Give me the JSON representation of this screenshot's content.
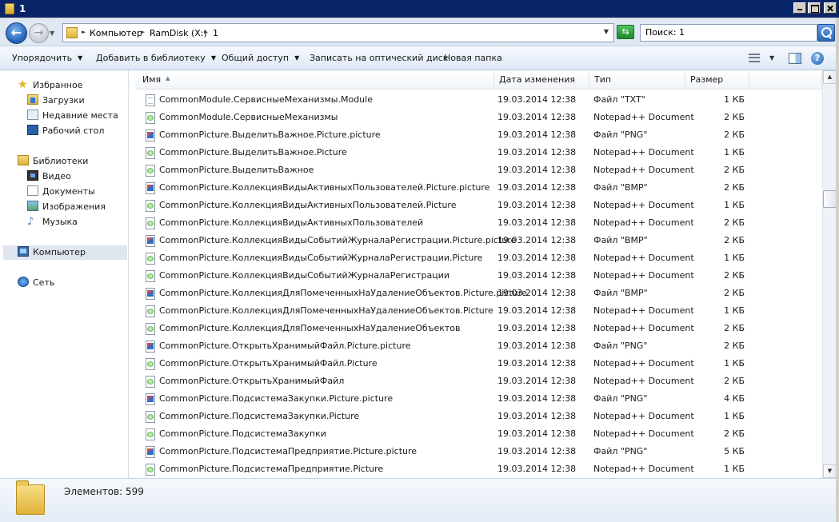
{
  "window": {
    "title": "1"
  },
  "address": {
    "crumbs": [
      "Компьютер",
      "RamDisk (X:)",
      "1"
    ],
    "search_placeholder": "Поиск: 1"
  },
  "toolbar": {
    "organize": "Упорядочить",
    "add_to_library": "Добавить в библиотеку",
    "share": "Общий доступ",
    "burn": "Записать на оптический диск",
    "new_folder": "Новая папка"
  },
  "nav": {
    "favorites": "Избранное",
    "downloads": "Загрузки",
    "recent": "Недавние места",
    "desktop": "Рабочий стол",
    "libraries": "Библиотеки",
    "video": "Видео",
    "documents": "Документы",
    "pictures": "Изображения",
    "music": "Музыка",
    "computer": "Компьютер",
    "network": "Сеть"
  },
  "columns": {
    "name": "Имя",
    "date": "Дата изменения",
    "type": "Тип",
    "size": "Размер"
  },
  "files": [
    {
      "icon": "txt",
      "name": "CommonModule.СервисныеМеханизмы.Module",
      "date": "19.03.2014 12:38",
      "type": "Файл \"TXT\"",
      "size": "1 КБ"
    },
    {
      "icon": "npp",
      "name": "CommonModule.СервисныеМеханизмы",
      "date": "19.03.2014 12:38",
      "type": "Notepad++ Document",
      "size": "2 КБ"
    },
    {
      "icon": "img",
      "name": "CommonPicture.ВыделитьВажное.Picture.picture",
      "date": "19.03.2014 12:38",
      "type": "Файл \"PNG\"",
      "size": "2 КБ"
    },
    {
      "icon": "npp",
      "name": "CommonPicture.ВыделитьВажное.Picture",
      "date": "19.03.2014 12:38",
      "type": "Notepad++ Document",
      "size": "1 КБ"
    },
    {
      "icon": "npp",
      "name": "CommonPicture.ВыделитьВажное",
      "date": "19.03.2014 12:38",
      "type": "Notepad++ Document",
      "size": "2 КБ"
    },
    {
      "icon": "img",
      "name": "CommonPicture.КоллекцияВидыАктивныхПользователей.Picture.picture",
      "date": "19.03.2014 12:38",
      "type": "Файл \"BMP\"",
      "size": "2 КБ"
    },
    {
      "icon": "npp",
      "name": "CommonPicture.КоллекцияВидыАктивныхПользователей.Picture",
      "date": "19.03.2014 12:38",
      "type": "Notepad++ Document",
      "size": "1 КБ"
    },
    {
      "icon": "npp",
      "name": "CommonPicture.КоллекцияВидыАктивныхПользователей",
      "date": "19.03.2014 12:38",
      "type": "Notepad++ Document",
      "size": "2 КБ"
    },
    {
      "icon": "img",
      "name": "CommonPicture.КоллекцияВидыСобытийЖурналаРегистрации.Picture.picture",
      "date": "19.03.2014 12:38",
      "type": "Файл \"BMP\"",
      "size": "2 КБ"
    },
    {
      "icon": "npp",
      "name": "CommonPicture.КоллекцияВидыСобытийЖурналаРегистрации.Picture",
      "date": "19.03.2014 12:38",
      "type": "Notepad++ Document",
      "size": "1 КБ"
    },
    {
      "icon": "npp",
      "name": "CommonPicture.КоллекцияВидыСобытийЖурналаРегистрации",
      "date": "19.03.2014 12:38",
      "type": "Notepad++ Document",
      "size": "2 КБ"
    },
    {
      "icon": "img",
      "name": "CommonPicture.КоллекцияДляПомеченныхНаУдалениеОбъектов.Picture.picture",
      "date": "19.03.2014 12:38",
      "type": "Файл \"BMP\"",
      "size": "2 КБ"
    },
    {
      "icon": "npp",
      "name": "CommonPicture.КоллекцияДляПомеченныхНаУдалениеОбъектов.Picture",
      "date": "19.03.2014 12:38",
      "type": "Notepad++ Document",
      "size": "1 КБ"
    },
    {
      "icon": "npp",
      "name": "CommonPicture.КоллекцияДляПомеченныхНаУдалениеОбъектов",
      "date": "19.03.2014 12:38",
      "type": "Notepad++ Document",
      "size": "2 КБ"
    },
    {
      "icon": "img",
      "name": "CommonPicture.ОткрытьХранимыйФайл.Picture.picture",
      "date": "19.03.2014 12:38",
      "type": "Файл \"PNG\"",
      "size": "2 КБ"
    },
    {
      "icon": "npp",
      "name": "CommonPicture.ОткрытьХранимыйФайл.Picture",
      "date": "19.03.2014 12:38",
      "type": "Notepad++ Document",
      "size": "1 КБ"
    },
    {
      "icon": "npp",
      "name": "CommonPicture.ОткрытьХранимыйФайл",
      "date": "19.03.2014 12:38",
      "type": "Notepad++ Document",
      "size": "2 КБ"
    },
    {
      "icon": "img",
      "name": "CommonPicture.ПодсистемаЗакупки.Picture.picture",
      "date": "19.03.2014 12:38",
      "type": "Файл \"PNG\"",
      "size": "4 КБ"
    },
    {
      "icon": "npp",
      "name": "CommonPicture.ПодсистемаЗакупки.Picture",
      "date": "19.03.2014 12:38",
      "type": "Notepad++ Document",
      "size": "1 КБ"
    },
    {
      "icon": "npp",
      "name": "CommonPicture.ПодсистемаЗакупки",
      "date": "19.03.2014 12:38",
      "type": "Notepad++ Document",
      "size": "2 КБ"
    },
    {
      "icon": "img",
      "name": "CommonPicture.ПодсистемаПредприятие.Picture.picture",
      "date": "19.03.2014 12:38",
      "type": "Файл \"PNG\"",
      "size": "5 КБ"
    },
    {
      "icon": "npp",
      "name": "CommonPicture.ПодсистемаПредприятие.Picture",
      "date": "19.03.2014 12:38",
      "type": "Notepad++ Document",
      "size": "1 КБ"
    }
  ],
  "status": {
    "items_count": "Элементов: 599"
  }
}
